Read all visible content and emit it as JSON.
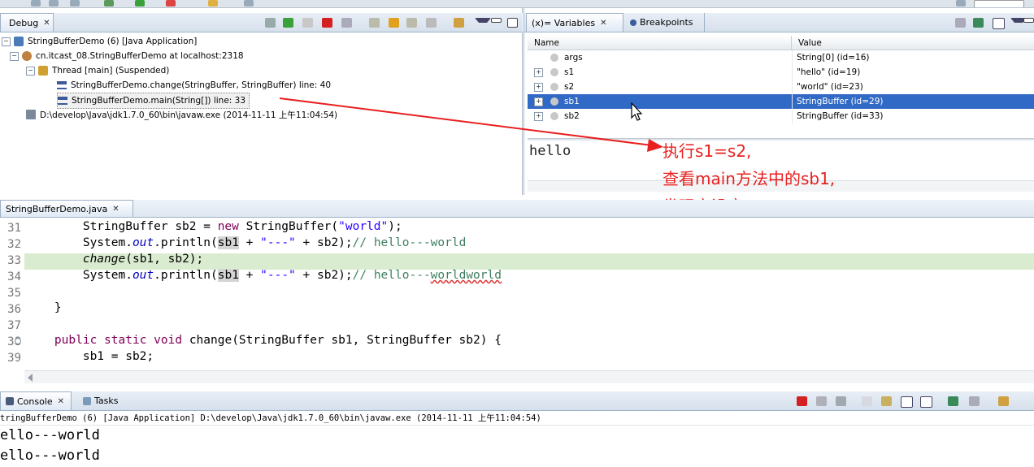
{
  "debug_view": {
    "tab_label": "Debug",
    "tree": [
      {
        "label": "StringBufferDemo (6) [Java Application]"
      },
      {
        "label": "cn.itcast_08.StringBufferDemo at localhost:2318"
      },
      {
        "label": "Thread [main] (Suspended)"
      },
      {
        "label": "StringBufferDemo.change(StringBuffer, StringBuffer) line: 40"
      },
      {
        "label": "StringBufferDemo.main(String[]) line: 33"
      },
      {
        "label": "D:\\develop\\Java\\jdk1.7.0_60\\bin\\javaw.exe (2014-11-11 上午11:04:54)"
      }
    ]
  },
  "variables_view": {
    "tabs": [
      {
        "label": "(x)= Variables"
      },
      {
        "label": "Breakpoints"
      }
    ],
    "columns": [
      "Name",
      "Value"
    ],
    "rows": [
      {
        "name": "args",
        "value": "String[0]  (id=16)",
        "expandable": false,
        "selected": false
      },
      {
        "name": "s1",
        "value": "\"hello\" (id=19)",
        "expandable": true,
        "selected": false
      },
      {
        "name": "s2",
        "value": "\"world\" (id=23)",
        "expandable": true,
        "selected": false
      },
      {
        "name": "sb1",
        "value": "StringBuffer  (id=29)",
        "expandable": true,
        "selected": true
      },
      {
        "name": "sb2",
        "value": "StringBuffer  (id=33)",
        "expandable": true,
        "selected": false
      }
    ],
    "detail_text": "hello"
  },
  "annotation": {
    "line1": "执行s1=s2,",
    "line2": "查看main方法中的sb1,",
    "line3": "发现它没变",
    "color": "#e82020"
  },
  "editor": {
    "tab_label": "StringBufferDemo.java",
    "line_numbers": [
      "31",
      "32",
      "33",
      "34",
      "35",
      "36",
      "37",
      "38",
      "39"
    ],
    "current_line": "33"
  },
  "console_view": {
    "tabs": [
      {
        "label": "Console"
      },
      {
        "label": "Tasks"
      }
    ],
    "process_label": "tringBufferDemo (6) [Java Application] D:\\develop\\Java\\jdk1.7.0_60\\bin\\javaw.exe (2014-11-11 上午11:04:54)",
    "output": [
      "ello---world",
      "ello---world"
    ]
  }
}
